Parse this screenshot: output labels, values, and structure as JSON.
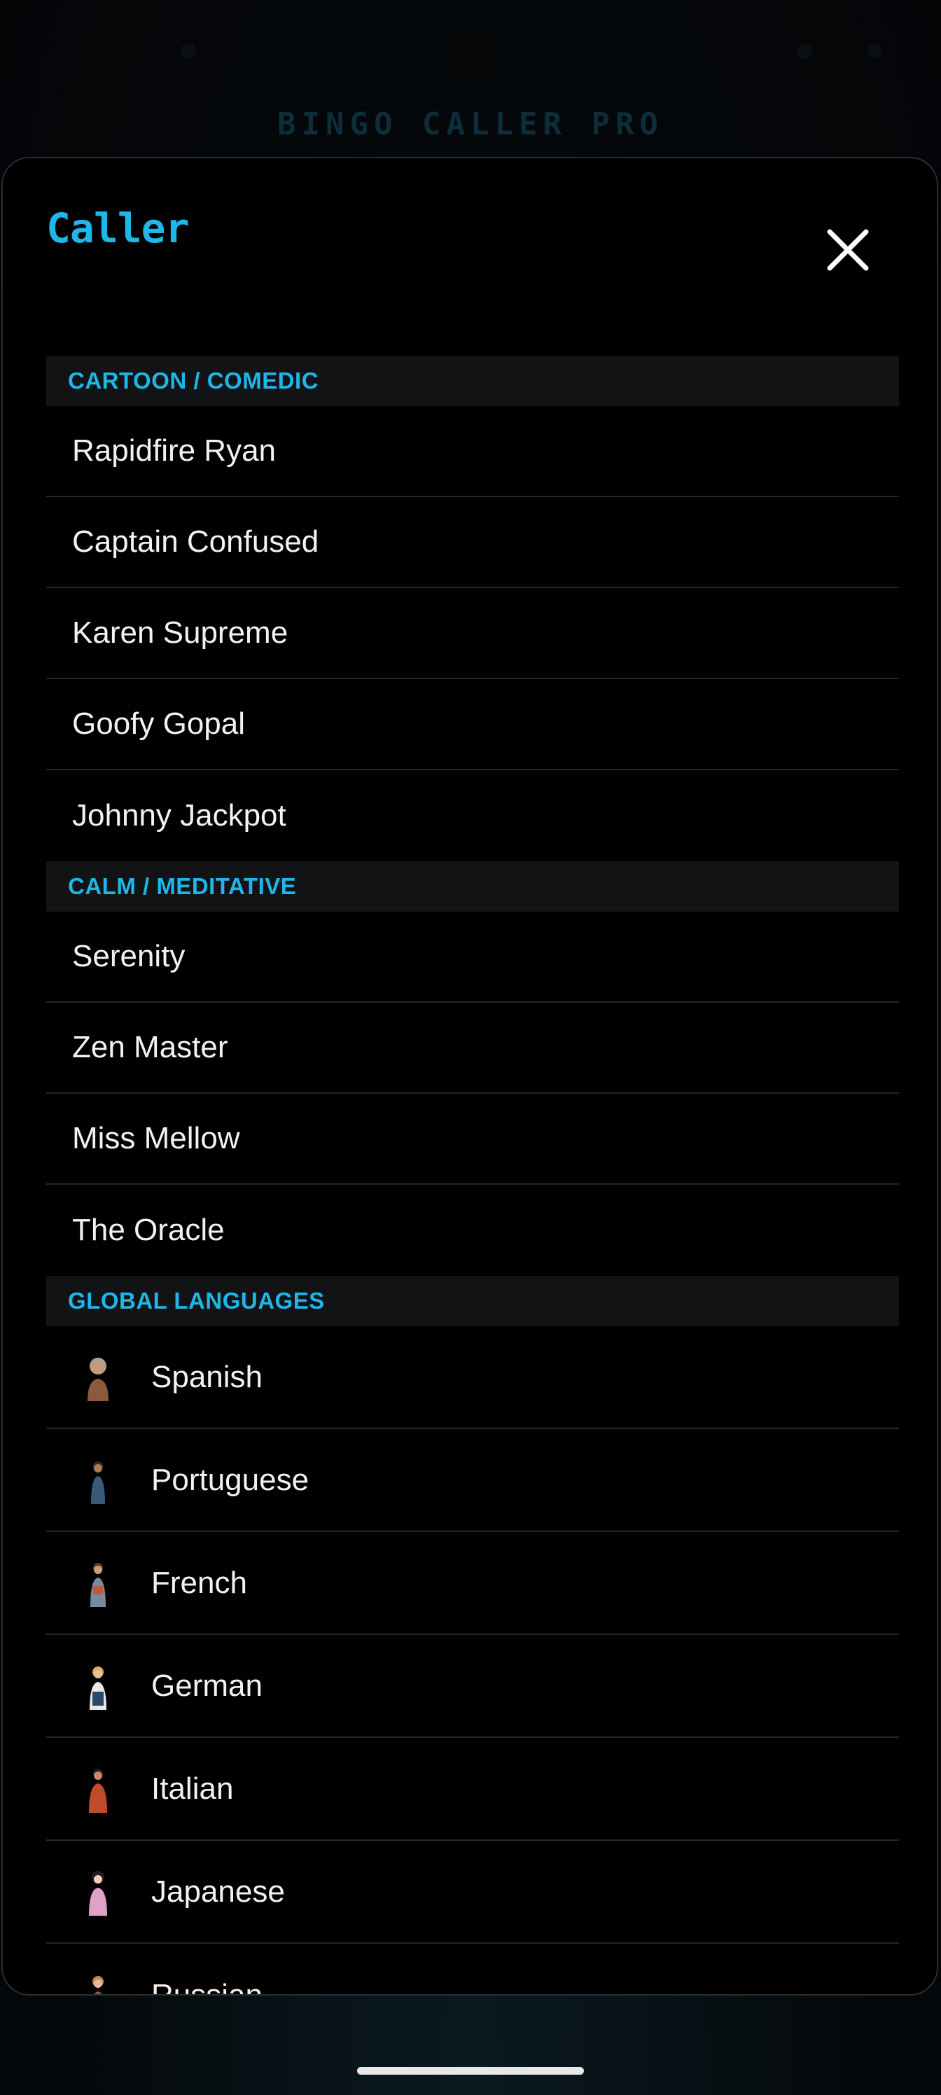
{
  "background_app": {
    "title": "BINGO CALLER PRO"
  },
  "sheet": {
    "title": "Caller",
    "close_icon": "close-icon"
  },
  "sections": {
    "cartoon": {
      "header": "CARTOON / COMEDIC",
      "items": [
        "Rapidfire Ryan",
        "Captain Confused",
        "Karen Supreme",
        "Goofy Gopal",
        "Johnny Jackpot"
      ]
    },
    "calm": {
      "header": "CALM / MEDITATIVE",
      "items": [
        "Serenity",
        "Zen Master",
        "Miss Mellow",
        "The Oracle"
      ]
    },
    "global": {
      "header": "GLOBAL LANGUAGES",
      "items": [
        "Spanish",
        "Portuguese",
        "French",
        "German",
        "Italian",
        "Japanese",
        "Russian"
      ]
    }
  },
  "colors": {
    "accent": "#1fb6e8",
    "sheet_background": "#000000",
    "section_header_background": "#111315",
    "item_text": "#f2f2f2",
    "divider": "#24272b"
  }
}
